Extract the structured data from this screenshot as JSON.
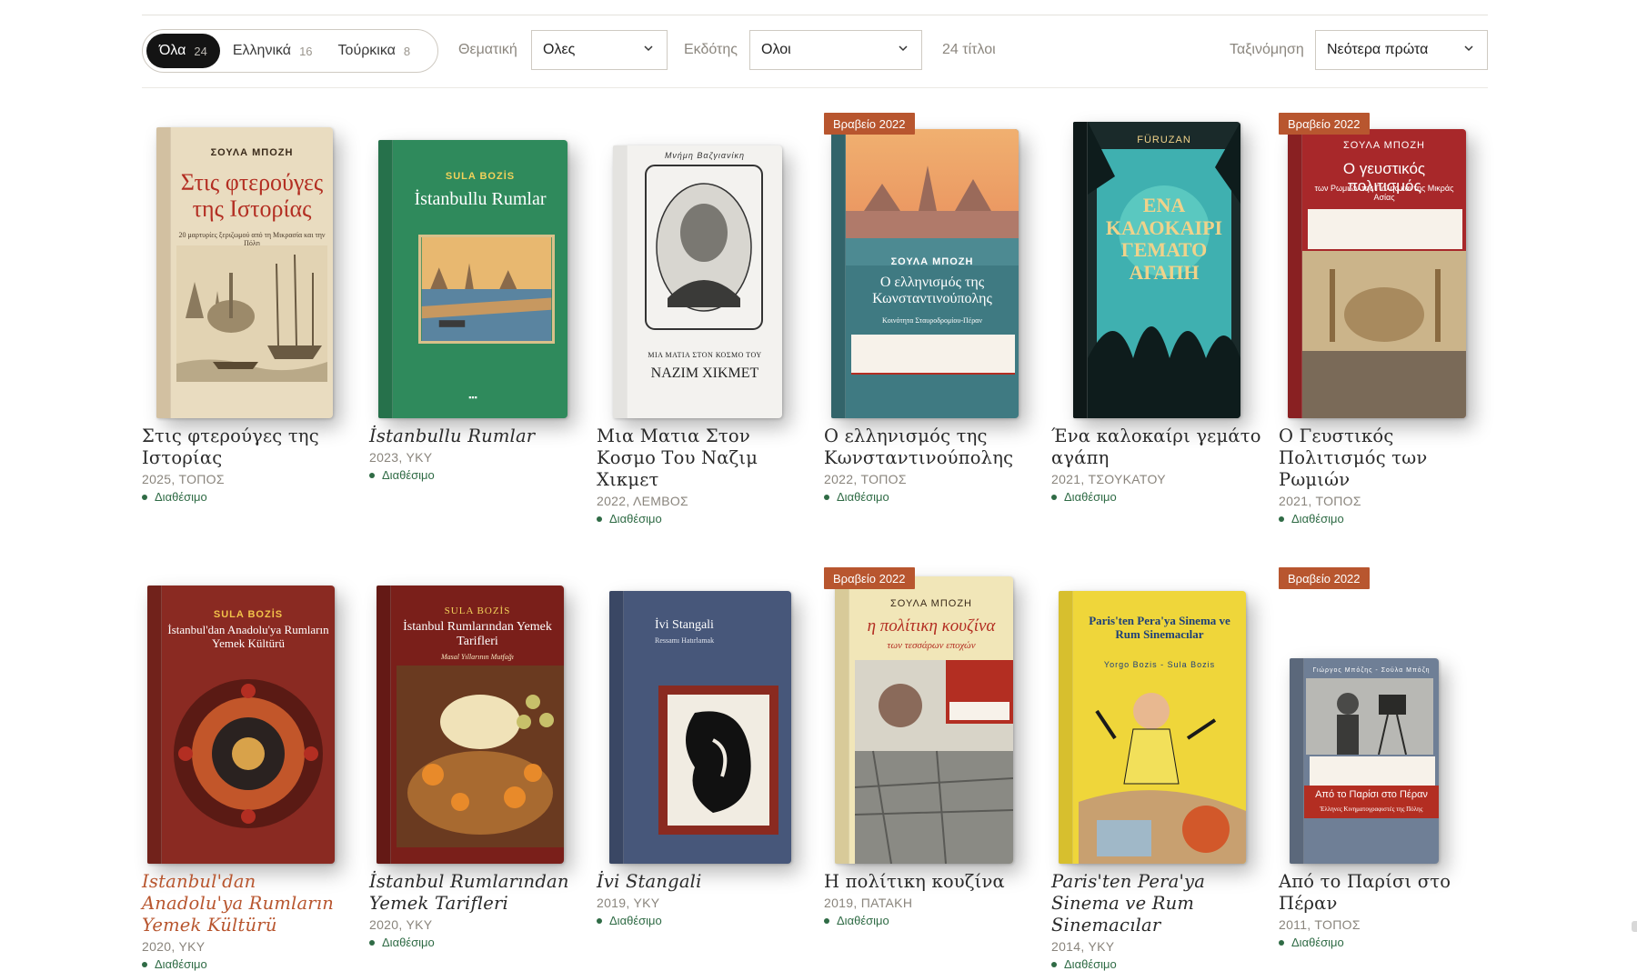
{
  "filters": {
    "segments": [
      {
        "label": "Όλα",
        "count": "24"
      },
      {
        "label": "Ελληνικά",
        "count": "16"
      },
      {
        "label": "Τούρκικα",
        "count": "8"
      }
    ],
    "theme_label": "Θεματική",
    "theme_value": "Ολες",
    "publisher_label": "Εκδότης",
    "publisher_value": "Ολοι",
    "result_count": "24 τίτλοι",
    "sort_label": "Ταξινόμηση",
    "sort_value": "Νεότερα πρώτα"
  },
  "badge_text": "Βραβείο 2022",
  "availability": "Διαθέσιμο",
  "books": [
    {
      "title": "Στις φτερούγες της Ιστορίας",
      "meta": "2025, ΤΟΠΟΣ",
      "cover": {
        "author": "ΣΟΥΛΑ ΜΠΟΖΗ",
        "title": "Στις φτερούγες της Ιστορίας",
        "sub": "20 μαρτυρίες ξεριζωμού από τη Μικρασία και την Πόλη",
        "bg": "#e9dcc0",
        "fg": "#b32e22"
      }
    },
    {
      "title": "İstanbullu Rumlar",
      "meta": "2023, YKY",
      "cover": {
        "author": "SULA BOZİS",
        "title": "İstanbullu Rumlar",
        "bg": "#2f8a5c",
        "fg": "#ffffff",
        "author_color": "#f2d25a"
      }
    },
    {
      "title": "Μια Ματια Στον Κοσμο Του Ναζιμ Χικμετ",
      "meta": "2022, ΛΕΜΒΟΣ",
      "cover": {
        "author": "Μνήμη Βαζγιανίκη",
        "title": "ΝΑΖΙΜ ΧΙΚΜΕΤ",
        "sub": "ΜΙΑ ΜΑΤΙΑ ΣΤΟΝ ΚΟΣΜΟ ΤΟΥ",
        "bg": "#f3f2ef",
        "fg": "#222222"
      }
    },
    {
      "title": "Ο ελληνισμός της Κωνσταντινούπολης",
      "meta": "2022, ΤΟΠΟΣ",
      "award": true,
      "cover": {
        "author": "ΣΟΥΛΑ ΜΠΟΖΗ",
        "title": "Ο ελληνισμός της Κωνσταντινούπολης",
        "sub": "Κοινότητα Σταυροδρομίου-Πέραν",
        "bg": "#3f7a82",
        "fg": "#ffffff"
      }
    },
    {
      "title": "Ένα καλοκαίρι γεμάτο αγάπη",
      "meta": "2021, ΤΣΟΥΚΑΤΟΥ",
      "cover": {
        "author": "FÜRUZAN",
        "title": "ΕΝΑ ΚΑΛΟΚΑΙΡΙ ΓΕΜΑΤΟ ΑΓΑΠΗ",
        "bg": "#1a2a2a",
        "fg": "#f0d28a"
      }
    },
    {
      "title": "Ο Γευστικός Πολιτισμός των Ρωμιών",
      "meta": "2021, ΤΟΠΟΣ",
      "award": true,
      "cover": {
        "author": "ΣΟΥΛΑ ΜΠΟΖΗ",
        "title": "Ο γευστικός πολιτισμός",
        "sub": "των Ρωμιών της Πόλης και της Μικράς Ασίας",
        "bg": "#a8282a",
        "fg": "#ffffff"
      }
    },
    {
      "title": "Istanbul'dan Anadolu'ya Rumların Yemek Kültürü",
      "meta": "2020, YKY",
      "cover": {
        "author": "SULA BOZİS",
        "title": "İstanbul'dan Anadolu'ya Rumların Yemek Kültürü",
        "bg": "#8a2a22",
        "fg": "#ffffff",
        "author_color": "#f2c24a"
      }
    },
    {
      "title": "İstanbul Rumlarından Yemek Tarifleri",
      "meta": "2020, YKY",
      "cover": {
        "author": "SULA BOZİS",
        "title": "İstanbul Rumlarından Yemek Tarifleri",
        "sub": "Masal Yıllarının Mutfağı",
        "bg": "#7a1f1a",
        "fg": "#ffffff",
        "author_color": "#f2d25a"
      }
    },
    {
      "title": "İvi Stangali",
      "meta": "2019, YKY",
      "cover": {
        "author": "",
        "title": "İvi Stangali",
        "sub": "Ressamı Hatırlamak",
        "bg": "#47577a",
        "fg": "#ffffff"
      }
    },
    {
      "title": "Η πολίτικη κουζίνα",
      "meta": "2019, ΠΑΤΑΚΗ",
      "award": true,
      "cover": {
        "author": "ΣΟΥΛΑ ΜΠΟΖΗ",
        "title": "η πολίτικη κουζίνα",
        "sub": "των τεσσάρων εποχών",
        "bg": "#f1e6b8",
        "fg": "#b32e22"
      }
    },
    {
      "title": "Paris'ten Pera'ya Sinema ve Rum Sinemacılar",
      "meta": "2014, YKY",
      "cover": {
        "author": "Yorgo Bozis - Sula Bozis",
        "title": "Paris'ten Pera'ya Sinema ve Rum Sinemacılar",
        "bg": "#efd63a",
        "fg": "#1d3f7a"
      }
    },
    {
      "title": "Από το Παρίσι στο Πέραν",
      "meta": "2011, ΤΟΠΟΣ",
      "award": true,
      "cover": {
        "author": "Γιώργος Μπόζης - Σούλα Μπόζη",
        "title": "Από το Παρίσι στο Πέραν",
        "sub": "Έλληνες Κινηματογραφιστές της Πόλης",
        "bg": "#6f7f96",
        "fg": "#ffffff"
      }
    }
  ],
  "icons": {
    "chevron": "chevron-down-icon",
    "dot": "status-dot-icon"
  },
  "colors": {
    "accent": "#b8562f",
    "available": "#2f6b45",
    "active_segment": "#141414"
  }
}
